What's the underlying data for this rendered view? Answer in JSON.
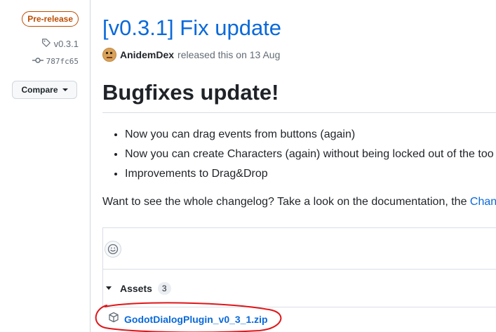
{
  "sidebar": {
    "badge": "Pre-release",
    "tag": "v0.3.1",
    "commit": "787fc65",
    "compare_label": "Compare"
  },
  "release": {
    "title": "[v0.3.1] Fix update",
    "author": "AnidemDex",
    "released_text": "released this on 13 Aug"
  },
  "body": {
    "heading": "Bugfixes update!",
    "bullets": [
      "Now you can drag events from buttons (again)",
      "Now you can create Characters (again) without being locked out of the too",
      "Improvements to Drag&Drop"
    ],
    "changelog_text": "Want to see the whole changelog? Take a look on the documentation, the ",
    "changelog_link": "Chan"
  },
  "assets": {
    "label": "Assets",
    "count": "3",
    "items": [
      {
        "name": "GodotDialogPlugin_v0_3_1.zip",
        "icon": "package-icon"
      }
    ]
  },
  "colors": {
    "link": "#0969da",
    "prerelease": "#bc4c00",
    "annotation": "#e0161a"
  }
}
